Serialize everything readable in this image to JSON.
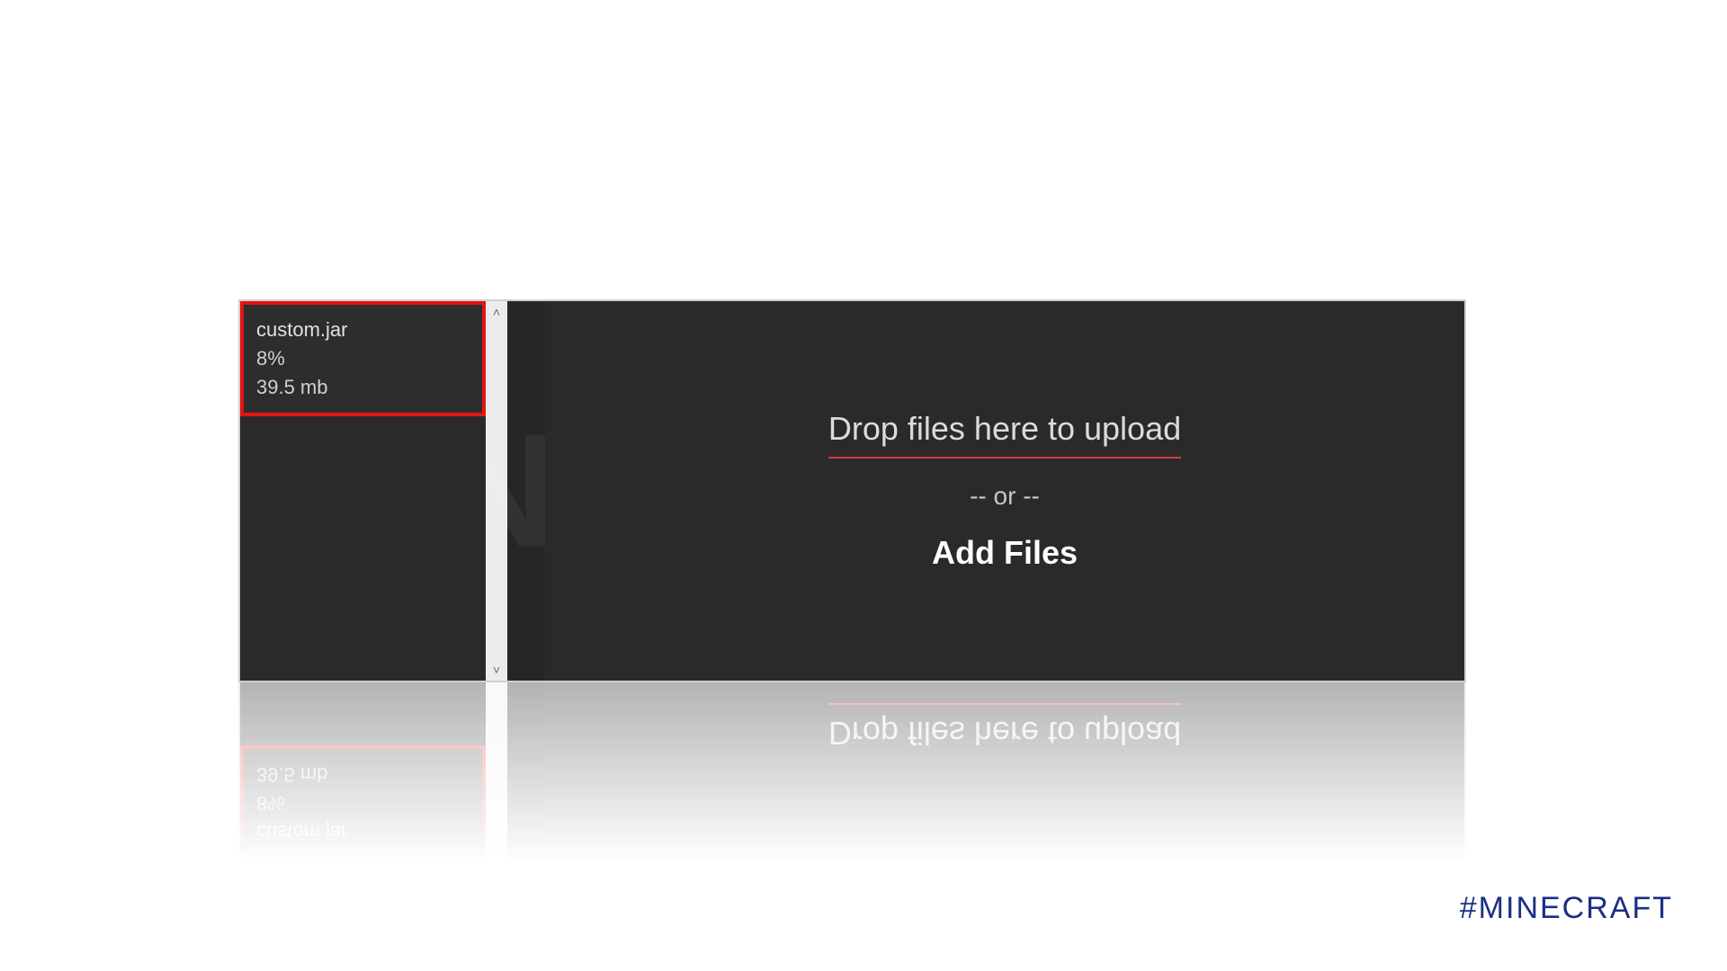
{
  "watermark": "NeuronVM",
  "hashtag": "#MINECRAFT",
  "file": {
    "name": "custom.jar",
    "progress": "8%",
    "size": "39.5 mb"
  },
  "drop": {
    "title": "Drop files here to upload",
    "or": "-- or --",
    "add": "Add Files"
  },
  "scroll": {
    "up": "˄",
    "down": "˅"
  }
}
